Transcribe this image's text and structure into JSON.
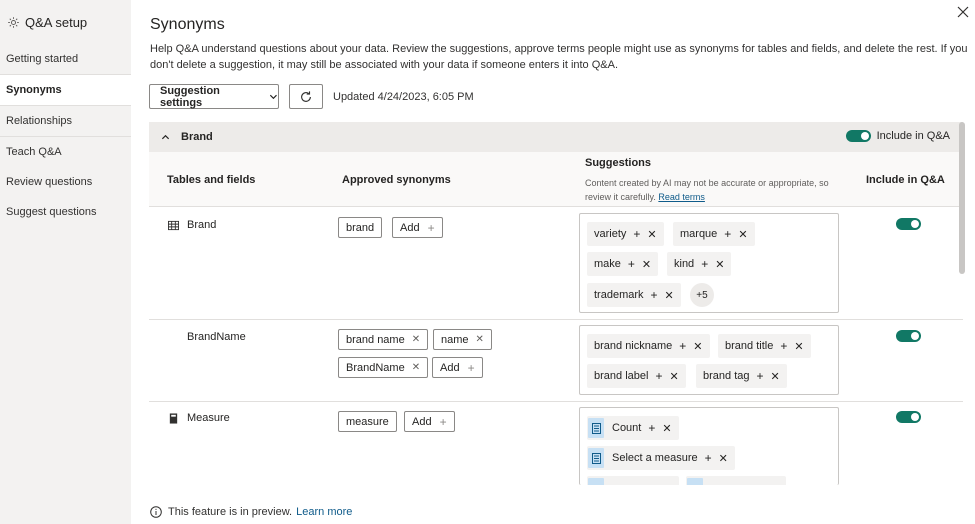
{
  "sidebar": {
    "title": "Q&A setup",
    "items": [
      {
        "label": "Getting started"
      },
      {
        "label": "Synonyms"
      },
      {
        "label": "Relationships"
      },
      {
        "label": "Teach Q&A"
      },
      {
        "label": "Review questions"
      },
      {
        "label": "Suggest questions"
      }
    ],
    "active": "Synonyms"
  },
  "main": {
    "title": "Synonyms",
    "description": "Help Q&A understand questions about your data. Review the suggestions, approve terms people might use as synonyms for tables and fields, and delete the rest. If you don't delete a suggestion, it may still be associated with your data if someone enters it into Q&A.",
    "settings_button": "Suggestion settings",
    "updated": "Updated 4/24/2023, 6:05 PM"
  },
  "section": {
    "title": "Brand",
    "include_label": "Include in Q&A",
    "include_on": true
  },
  "columns": {
    "tables_fields": "Tables and fields",
    "approved": "Approved synonyms",
    "suggestions": "Suggestions",
    "suggestions_note": "Content created by AI may not be accurate or appropriate, so review it carefully.",
    "read_terms": "Read terms",
    "include": "Include in Q&A"
  },
  "add_label": "Add",
  "rows": [
    {
      "field": "Brand",
      "icon": "table-icon",
      "approved": [
        "brand"
      ],
      "suggestions": [
        "variety",
        "marque",
        "make",
        "kind",
        "trademark"
      ],
      "more": "+5",
      "include_on": true
    },
    {
      "field": "BrandName",
      "icon": "",
      "approved": [
        "brand name",
        "name",
        "BrandName"
      ],
      "suggestions": [
        "brand nickname",
        "brand title",
        "brand label",
        "brand tag"
      ],
      "include_on": true
    },
    {
      "field": "Measure",
      "icon": "calculator-icon",
      "approved": [
        "measure"
      ],
      "suggestions": [
        "Count",
        "Select a measure"
      ],
      "include_on": true
    }
  ],
  "footer": {
    "text": "This feature is in preview.",
    "link": "Learn more"
  },
  "colors": {
    "accent": "#117865",
    "link": "#0f5b8a",
    "sidebar_bg": "#f3f2f1"
  }
}
